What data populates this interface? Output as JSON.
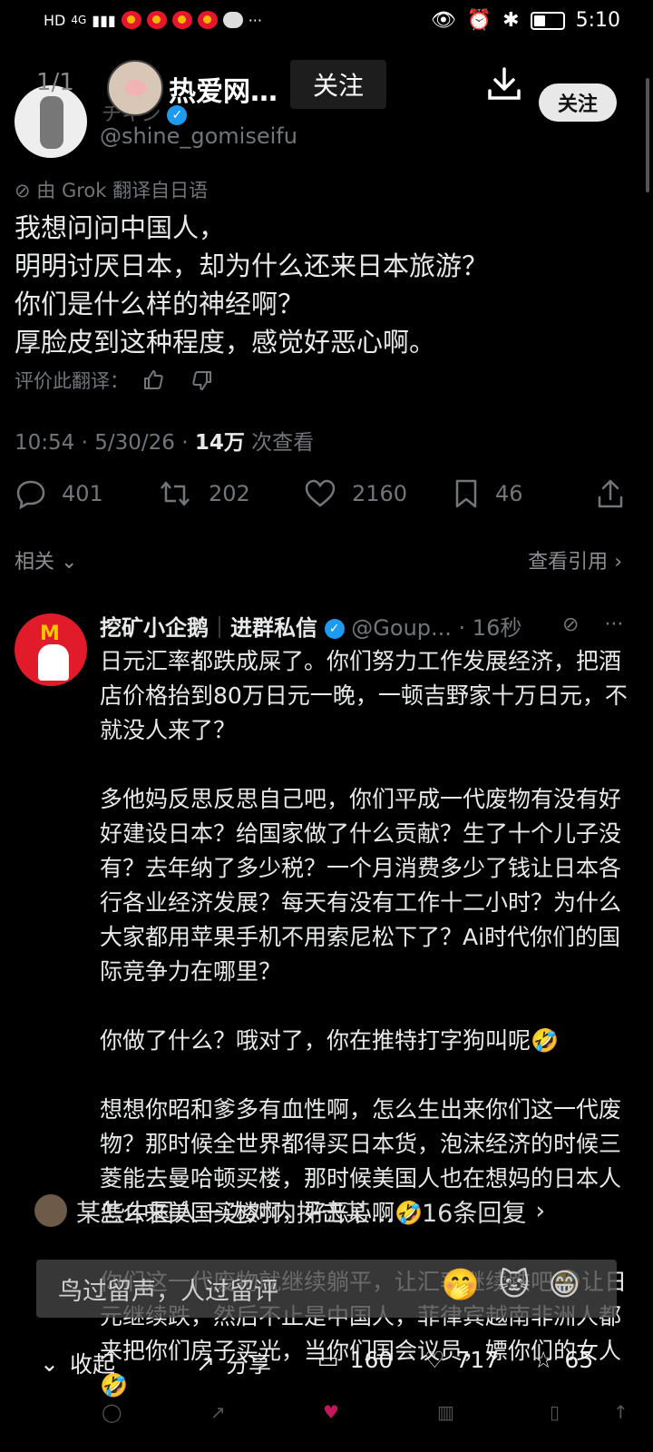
{
  "status_bar": {
    "left_text": "HD",
    "signal": "4G",
    "time": "5:10",
    "more": "···"
  },
  "header": {
    "pager": "1/1",
    "account_name": "热爱网…",
    "follow_dark": "关注",
    "follow_pill": "关注"
  },
  "tweet": {
    "author_partial": "チキン",
    "handle": "@shine_gomiseifu",
    "translated_by": "由 Grok 翻译自日语",
    "text": "我想问问中国人，\n明明讨厌日本，却为什么还来日本旅游？\n你们是什么样的神经啊？\n厚脸皮到这种程度，感觉好恶心啊。",
    "rate_translation": "评价此翻译：",
    "timestamp": "10:54 · 5/30/26 · ",
    "views_count": "14万",
    "views_label": " 次查看",
    "stats": {
      "replies": "401",
      "retweets": "202",
      "likes": "2160",
      "bookmarks": "46"
    }
  },
  "related_label": "相关",
  "view_quotes": "查看引用",
  "reply": {
    "name": "挖矿小企鹅",
    "separator": "｜",
    "group": "进群私信",
    "handle": "@Goup...",
    "time": " · 16秒",
    "paragraphs": [
      "日元汇率都跌成屎了。你们努力工作发展经济，把酒店价格抬到80万日元一晚，一顿吉野家十万日元，不就没人来了？",
      "多他妈反思反思自己吧，你们平成一代废物有没有好好建设日本？给国家做了什么贡献？生了十个儿子没有？去年纳了多少税？一个月消费多少了钱让日本各行各业经济发展？每天有没有工作十二小时？为什么大家都用苹果手机不用索尼松下了？Ai时代你们的国际竞争力在哪里？",
      "你做了什么？哦对了，你在推特打字狗叫呢🤣",
      "想想你昭和爹多有血性啊，怎么生出来你们这一代废物？那时候全世界都得买日本货，泡沫经济的时候三菱能去曼哈顿买楼，那时候美国人也在想妈的日本人怎么来美国买楼啊，好恶心啊🤣",
      "你们这一代废物就继续躺平，让汇率继续跌吧🤣让日元继续跌，然后不止是中国人，菲律宾越南非洲人都来把你们房子买光，当你们国会议员，嫖你们的女人🤣"
    ]
  },
  "overlay": {
    "topic_title": "某些中国人一边对内抨击某…",
    "topic_replies": "16条回复",
    "comment_placeholder": "鸟过留声，人过留评",
    "emojis": [
      "🤭",
      "🐱",
      "😁"
    ],
    "collapse": "收起",
    "share": "分享",
    "comments": "160",
    "likes": "717",
    "favorites": "65"
  },
  "colors": {
    "background": "#000000",
    "text": "#e7e9ea",
    "muted": "#71767b",
    "verified": "#1d9bf0"
  }
}
